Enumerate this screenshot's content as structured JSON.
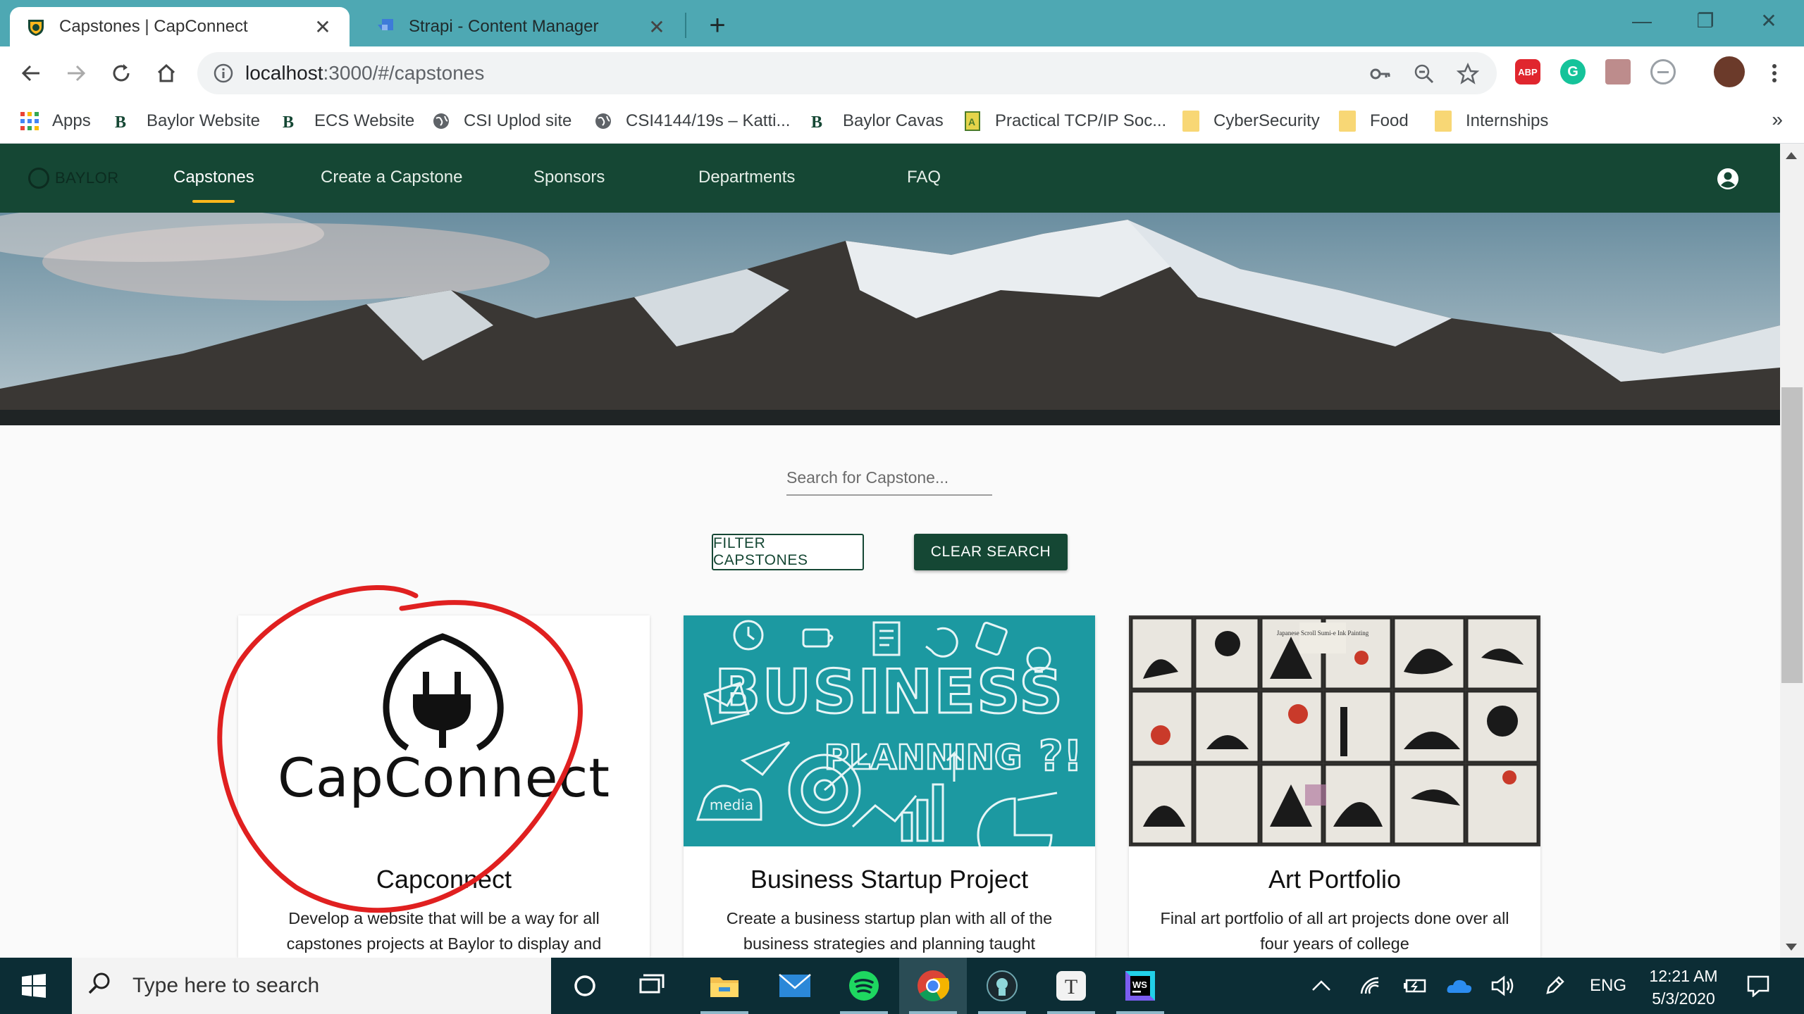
{
  "browser": {
    "tabs": [
      {
        "title": "Capstones | CapConnect",
        "active": true
      },
      {
        "title": "Strapi - Content Manager",
        "active": false
      }
    ],
    "new_tab": "+",
    "window_controls": {
      "minimize": "—",
      "restore": "❐",
      "close": "✕"
    },
    "tab_close": "✕",
    "url_host": "localhost",
    "url_path": ":3000/#/capstones",
    "extensions": [
      "ABP",
      "G"
    ]
  },
  "bookmarks": [
    {
      "label": "Apps",
      "icon": "apps-grid-icon"
    },
    {
      "label": "Baylor Website",
      "icon": "baylor-icon"
    },
    {
      "label": "ECS Website",
      "icon": "baylor-icon"
    },
    {
      "label": "CSI Uplod site",
      "icon": "globe-icon"
    },
    {
      "label": "CSI4144/19s – Katti...",
      "icon": "globe-icon"
    },
    {
      "label": "Baylor Cavas",
      "icon": "baylor-icon"
    },
    {
      "label": "Practical TCP/IP Soc...",
      "icon": "book-icon"
    },
    {
      "label": "CyberSecurity",
      "icon": "folder-icon"
    },
    {
      "label": "Food",
      "icon": "folder-icon"
    },
    {
      "label": "Internships",
      "icon": "folder-icon"
    }
  ],
  "bookmarks_more": "»",
  "site": {
    "brand": "BAYLOR",
    "nav": [
      "Capstones",
      "Create a Capstone",
      "Sponsors",
      "Departments",
      "FAQ"
    ],
    "active_nav": "Capstones",
    "search_placeholder": "Search for Capstone...",
    "filter_button": "FILTER CAPSTONES",
    "clear_button": "CLEAR SEARCH",
    "logo_text": "CapConnect",
    "cards": [
      {
        "title": "Capconnect",
        "description": "Develop a website that will be a way for all capstones projects at Baylor to display and"
      },
      {
        "title": "Business Startup Project",
        "description": "Create a business startup plan with all of the business strategies and planning taught"
      },
      {
        "title": "Art Portfolio",
        "description": "Final art portfolio of all art projects done over all four years of college"
      }
    ],
    "business_image_text": [
      "BUSINESS",
      "PLANNING",
      "?!",
      "media"
    ],
    "art_image_text": "Japanese Scroll Sumi-e Ink Painting"
  },
  "taskbar": {
    "search_placeholder": "Type here to search",
    "language": "ENG",
    "time": "12:21 AM",
    "date": "5/3/2020"
  },
  "colors": {
    "baylor_green": "#154734",
    "baylor_gold": "#ffb81c",
    "tab_strip": "#4ea8b3",
    "annotation_red": "#e02020",
    "taskbar": "#0c2d35"
  }
}
